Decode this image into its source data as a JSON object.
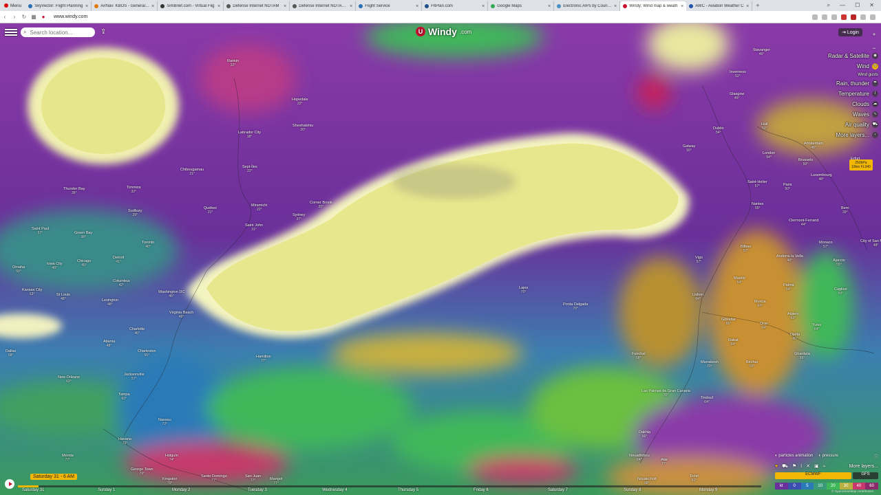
{
  "browser": {
    "menu_label": "Menu",
    "tabs": [
      {
        "title": "SkyVector: Flight Planning",
        "color": "#2a6fb0"
      },
      {
        "title": "AirNav: KBOS - General Ed",
        "color": "#e07a10"
      },
      {
        "title": "SimBrief.com - Virtual Flig",
        "color": "#333333"
      },
      {
        "title": "Defense Internet NOTAM",
        "color": "#555555"
      },
      {
        "title": "Defense Internet NOTAM S",
        "color": "#555555"
      },
      {
        "title": "Flight Service",
        "color": "#2a6fb0"
      },
      {
        "title": "FltPlan.com",
        "color": "#1e4f8a"
      },
      {
        "title": "Google Maps",
        "color": "#34a853"
      },
      {
        "title": "Electronic AIPs by Country",
        "color": "#4a90c2"
      },
      {
        "title": "Windy: Wind map & weath",
        "color": "#c8102e",
        "active": true
      },
      {
        "title": "AWC - Aviation Weather C",
        "color": "#2255aa"
      }
    ],
    "url": "www.windy.com"
  },
  "search": {
    "placeholder": "Search location..."
  },
  "logo": {
    "text": "Windy",
    "suffix": ".com"
  },
  "login_label": "Login",
  "layers": [
    {
      "label": "Radar & Satellite",
      "icon": "radar-icon"
    },
    {
      "label": "Wind",
      "icon": "wind-icon",
      "selected": true
    },
    {
      "label": "Wind gusts",
      "icon": "gust-icon",
      "sub": true
    },
    {
      "label": "Rain, thunder",
      "icon": "rain-icon"
    },
    {
      "label": "Temperature",
      "icon": "thermometer-icon"
    },
    {
      "label": "Clouds",
      "icon": "cloud-icon"
    },
    {
      "label": "Waves",
      "icon": "waves-icon"
    },
    {
      "label": "Air quality",
      "icon": "car-icon"
    },
    {
      "label": "More layers...",
      "icon": "chevron-left-icon"
    }
  ],
  "tip": {
    "line1": "250hPa",
    "line2": "10km FL340"
  },
  "options": {
    "particles": "particles animation",
    "pressure": "pressure"
  },
  "more_layers_short": "More layers...",
  "models": {
    "primary": "ECMWF",
    "secondary": "GFS"
  },
  "scale": {
    "unit": "kt",
    "values": [
      "0",
      "5",
      "10",
      "20",
      "30",
      "40",
      "60"
    ]
  },
  "timeline": {
    "current": "Saturday 31 - 6 AM",
    "days": [
      "Saturday 31",
      "Sunday 1",
      "Monday 2",
      "Tuesday 3",
      "Wednesday 4",
      "Thursday 5",
      "Friday 6",
      "Saturday 7",
      "Sunday 8",
      "Monday 9"
    ]
  },
  "attribution": "© OpenStreetMap contributors",
  "places": [
    {
      "name": "Rankin",
      "temp": "32°"
    },
    {
      "name": "Hopedale",
      "temp": "22°"
    },
    {
      "name": "Labrador City",
      "temp": "18°"
    },
    {
      "name": "Sheshatshiu",
      "temp": "20°"
    },
    {
      "name": "Sept-Îles",
      "temp": "22°"
    },
    {
      "name": "Chibougamau",
      "temp": "21°"
    },
    {
      "name": "Thunder Bay",
      "temp": "35°"
    },
    {
      "name": "Timmins",
      "temp": "32°"
    },
    {
      "name": "Québec",
      "temp": "21°"
    },
    {
      "name": "Sudbury",
      "temp": "29°"
    },
    {
      "name": "Miramichi",
      "temp": "22°"
    },
    {
      "name": "Corner Brook",
      "temp": "20°"
    },
    {
      "name": "Sydney",
      "temp": "37°"
    },
    {
      "name": "Saint John",
      "temp": "31°"
    },
    {
      "name": "Saint Paul",
      "temp": "57°"
    },
    {
      "name": "Green Bay",
      "temp": "38°"
    },
    {
      "name": "Chicago",
      "temp": "45°"
    },
    {
      "name": "Detroit",
      "temp": "41°"
    },
    {
      "name": "Toronto",
      "temp": "40°"
    },
    {
      "name": "Omaha",
      "temp": "50°"
    },
    {
      "name": "Iowa City",
      "temp": "48°"
    },
    {
      "name": "Columbus",
      "temp": "42°"
    },
    {
      "name": "Kansas City",
      "temp": "53°"
    },
    {
      "name": "St Louis",
      "temp": "48°"
    },
    {
      "name": "Lexington",
      "temp": "48°"
    },
    {
      "name": "Washington DC",
      "temp": "45°"
    },
    {
      "name": "Virginia Beach",
      "temp": "49°"
    },
    {
      "name": "Charlotte",
      "temp": "46°"
    },
    {
      "name": "Atlanta",
      "temp": "48°"
    },
    {
      "name": "Dallas",
      "temp": "58°"
    },
    {
      "name": "Charleston",
      "temp": "55°"
    },
    {
      "name": "Jacksonville",
      "temp": "57°"
    },
    {
      "name": "New Orleans",
      "temp": "63°"
    },
    {
      "name": "Tampa",
      "temp": "63°"
    },
    {
      "name": "Hamilton",
      "temp": "77°"
    },
    {
      "name": "Nassau",
      "temp": "72°"
    },
    {
      "name": "Havana",
      "temp": "72°"
    },
    {
      "name": "Holguín",
      "temp": "74°"
    },
    {
      "name": "Mérida",
      "temp": "77°"
    },
    {
      "name": "George Town",
      "temp": "79°"
    },
    {
      "name": "Santo Domingo",
      "temp": "77°"
    },
    {
      "name": "San Juan",
      "temp": "77°"
    },
    {
      "name": "Kingston",
      "temp": "79°"
    },
    {
      "name": "Marigot",
      "temp": "77°"
    },
    {
      "name": "Lajes",
      "temp": "70°"
    },
    {
      "name": "Ponta Delgada",
      "temp": "70°"
    },
    {
      "name": "Funchal",
      "temp": "68°"
    },
    {
      "name": "Las Palmas de Gran Canaria",
      "temp": "70°"
    },
    {
      "name": "Dakhla",
      "temp": "66°"
    },
    {
      "name": "Nouadhibou",
      "temp": "64°"
    },
    {
      "name": "Nouakchott",
      "temp": "68°"
    },
    {
      "name": "Tichit",
      "temp": "82°"
    },
    {
      "name": "Atar",
      "temp": "77°"
    },
    {
      "name": "Tindouf",
      "temp": "64°"
    },
    {
      "name": "Béchar",
      "temp": "50°"
    },
    {
      "name": "Marrakesh",
      "temp": "70°"
    },
    {
      "name": "Rabat",
      "temp": "64°"
    },
    {
      "name": "Gibraltar",
      "temp": "66°"
    },
    {
      "name": "Oran",
      "temp": "64°"
    },
    {
      "name": "Lisbon",
      "temp": "64°"
    },
    {
      "name": "Madrid",
      "temp": "54°"
    },
    {
      "name": "Murcia",
      "temp": "64°"
    },
    {
      "name": "Vigo",
      "temp": "57°"
    },
    {
      "name": "Bilbao",
      "temp": "57°"
    },
    {
      "name": "Andorra la Vella",
      "temp": "48°"
    },
    {
      "name": "Palma",
      "temp": "64°"
    },
    {
      "name": "Algiers",
      "temp": "63°"
    },
    {
      "name": "Tunis",
      "temp": "64°"
    },
    {
      "name": "Djelfa",
      "temp": "46°"
    },
    {
      "name": "Ghardaïa",
      "temp": "55°"
    },
    {
      "name": "Cagliari",
      "temp": "59°"
    },
    {
      "name": "Ajaccio",
      "temp": "55°"
    },
    {
      "name": "Monaco",
      "temp": "57°"
    },
    {
      "name": "Nantes",
      "temp": "55°"
    },
    {
      "name": "Clermont-Ferrand",
      "temp": "44°"
    },
    {
      "name": "Paris",
      "temp": "50°"
    },
    {
      "name": "Saint-Helier",
      "temp": "57°"
    },
    {
      "name": "London",
      "temp": "54°"
    },
    {
      "name": "Brussels",
      "temp": "50°"
    },
    {
      "name": "Amsterdam",
      "temp": "48°"
    },
    {
      "name": "Luxembourg",
      "temp": "48°"
    },
    {
      "name": "Bern",
      "temp": "39°"
    },
    {
      "name": "Erfurt",
      "temp": "48°"
    },
    {
      "name": "Hull",
      "temp": "52°"
    },
    {
      "name": "Dublin",
      "temp": "54°"
    },
    {
      "name": "Glasgow",
      "temp": "46°"
    },
    {
      "name": "Inverness",
      "temp": "52°"
    },
    {
      "name": "Galway",
      "temp": "50°"
    },
    {
      "name": "Stavanger",
      "temp": "46°"
    },
    {
      "name": "City of San Marino",
      "temp": "48°"
    }
  ]
}
